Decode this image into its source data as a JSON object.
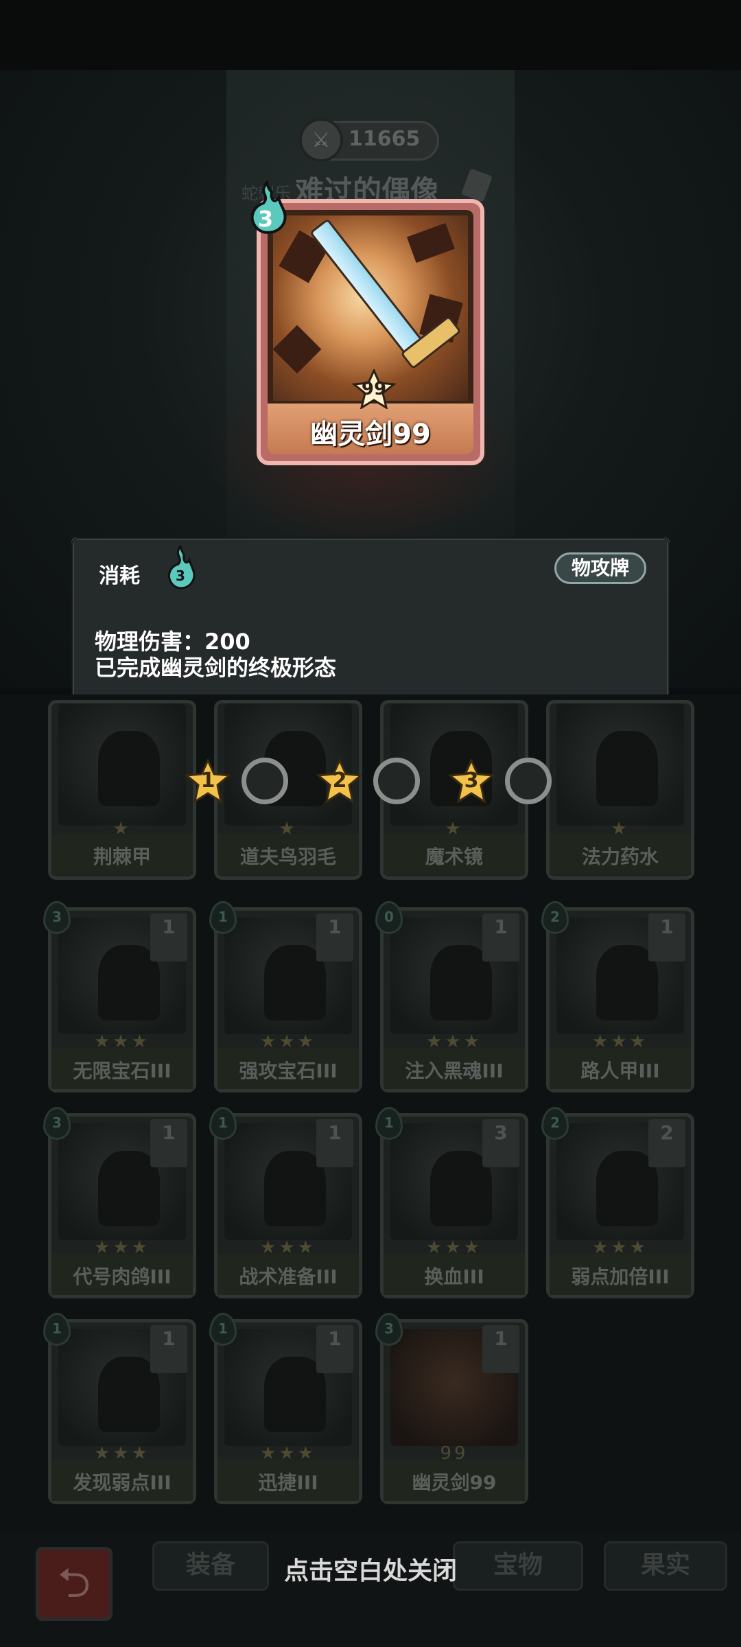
{
  "header": {
    "coins": "11665",
    "boss_prefix": "蛇刺乐",
    "boss_name": "难过的偶像"
  },
  "featured_card": {
    "cost": "3",
    "level": "99",
    "name": "幽灵剑99"
  },
  "info_panel": {
    "cost_label": "消耗",
    "cost_value": "3",
    "type_badge": "物攻牌",
    "description_lines": [
      "物理伤害：200",
      "已完成幽灵剑的终极形态"
    ]
  },
  "upgrade_slots": [
    "1",
    "2",
    "3"
  ],
  "deck_row1": [
    {
      "name": "荆棘甲",
      "stars": "★"
    },
    {
      "name": "道夫鸟羽毛",
      "stars": "★"
    },
    {
      "name": "魔术镜",
      "stars": "★"
    },
    {
      "name": "法力药水",
      "stars": "★"
    }
  ],
  "deck_rows": [
    {
      "name": "无限宝石III",
      "cost": "3",
      "count": "1",
      "stars": "★★★"
    },
    {
      "name": "强攻宝石III",
      "cost": "1",
      "count": "1",
      "stars": "★★★"
    },
    {
      "name": "注入黑魂III",
      "cost": "0",
      "count": "1",
      "stars": "★★★"
    },
    {
      "name": "路人甲III",
      "cost": "2",
      "count": "1",
      "stars": "★★★"
    },
    {
      "name": "代号肉鸽III",
      "cost": "3",
      "count": "1",
      "stars": "★★★"
    },
    {
      "name": "战术准备III",
      "cost": "1",
      "count": "1",
      "stars": "★★★"
    },
    {
      "name": "换血III",
      "cost": "1",
      "count": "3",
      "stars": "★★★"
    },
    {
      "name": "弱点加倍III",
      "cost": "2",
      "count": "2",
      "stars": "★★★"
    },
    {
      "name": "发现弱点III",
      "cost": "1",
      "count": "1",
      "stars": "★★★"
    },
    {
      "name": "迅捷III",
      "cost": "1",
      "count": "1",
      "stars": "★★★"
    },
    {
      "name": "幽灵剑99",
      "cost": "3",
      "count": "1",
      "stars": "99"
    }
  ],
  "bottom": {
    "tab_equip": "装备",
    "close_hint": "点击空白处关闭",
    "tab_treasure": "宝物",
    "tab_fruit": "果实"
  },
  "colors": {
    "accent_flame": "#5cc9bd",
    "card_frame": "#f0b7b0",
    "star_gold": "#f2c24a"
  }
}
